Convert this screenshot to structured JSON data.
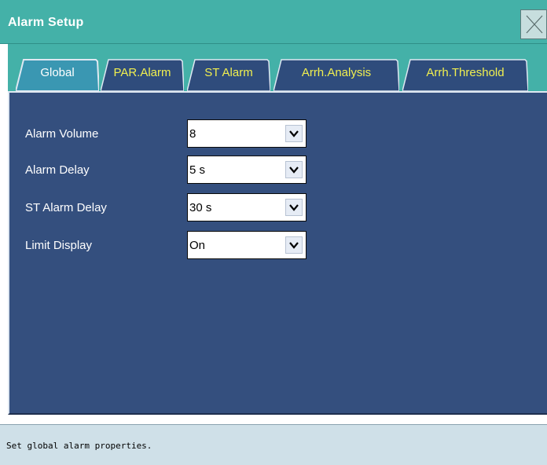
{
  "window": {
    "title": "Alarm Setup"
  },
  "tabs": [
    {
      "label": "Global",
      "active": true
    },
    {
      "label": "PAR.Alarm",
      "active": false
    },
    {
      "label": "ST Alarm",
      "active": false
    },
    {
      "label": "Arrh.Analysis",
      "active": false
    },
    {
      "label": "Arrh.Threshold",
      "active": false
    }
  ],
  "settings": [
    {
      "label": "Alarm Volume",
      "value": "8"
    },
    {
      "label": "Alarm Delay",
      "value": "5 s"
    },
    {
      "label": "ST Alarm Delay",
      "value": "30 s"
    },
    {
      "label": "Limit Display",
      "value": "On"
    }
  ],
  "status": {
    "text": "Set global alarm properties."
  },
  "icons": {
    "close": "close-icon",
    "dropdown_arrow": "chevron-down-icon"
  },
  "colors": {
    "title_bar": "#44b1a8",
    "panel": "#344f7e",
    "tab_active": "#3a97b2",
    "tab_inactive": "#2f4c7c",
    "tab_inactive_text": "#f1ef4f",
    "status_bar": "#cfe0e8"
  }
}
